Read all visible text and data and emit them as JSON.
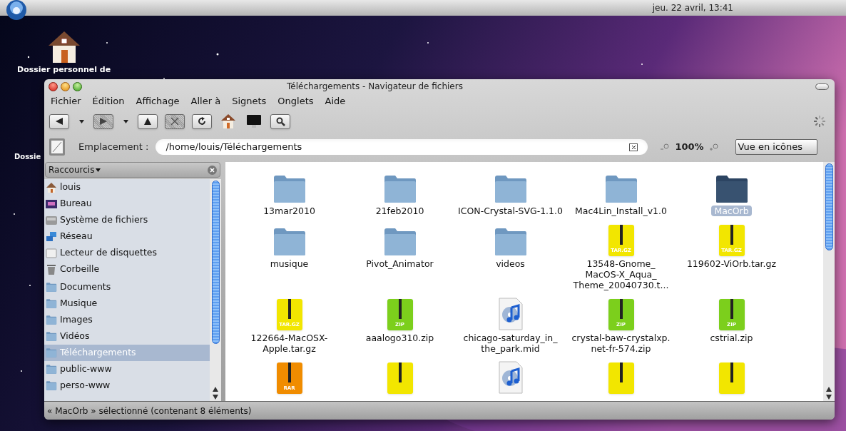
{
  "top_bar": {
    "clock": "jeu. 22 avril, 13:41"
  },
  "desktop_icons": [
    {
      "label": "Dossier personnel de",
      "kind": "home"
    },
    {
      "label": "Dossie",
      "kind": "hidden"
    }
  ],
  "window": {
    "title": "Téléchargements - Navigateur de fichiers"
  },
  "menu": [
    "Fichier",
    "Édition",
    "Affichage",
    "Aller à",
    "Signets",
    "Onglets",
    "Aide"
  ],
  "toolbar": [
    {
      "kind": "back",
      "disabled": false
    },
    {
      "kind": "dropdown",
      "disabled": false
    },
    {
      "kind": "forward",
      "disabled": true
    },
    {
      "kind": "dropdown",
      "disabled": false
    },
    {
      "kind": "up",
      "disabled": false
    },
    {
      "kind": "stop",
      "disabled": true
    },
    {
      "kind": "reload",
      "disabled": false
    },
    {
      "kind": "home",
      "disabled": false
    },
    {
      "kind": "computer",
      "disabled": false
    },
    {
      "kind": "search",
      "disabled": false
    }
  ],
  "location": {
    "label": "Emplacement :",
    "value": "/home/louis/Téléchargements",
    "zoom": "100%",
    "view": "Vue en icônes"
  },
  "sidebar": {
    "title": "Raccourcis",
    "items": [
      {
        "label": "louis",
        "kind": "home",
        "selected": false
      },
      {
        "label": "Bureau",
        "kind": "desktop",
        "selected": false
      },
      {
        "label": "Système de fichiers",
        "kind": "drive",
        "selected": false
      },
      {
        "label": "Réseau",
        "kind": "network",
        "selected": false
      },
      {
        "label": "Lecteur de disquettes",
        "kind": "floppy",
        "selected": false
      },
      {
        "label": "Corbeille",
        "kind": "trash",
        "selected": false
      },
      {
        "label": "Documents",
        "kind": "folder",
        "selected": false
      },
      {
        "label": "Musique",
        "kind": "folder",
        "selected": false
      },
      {
        "label": "Images",
        "kind": "folder",
        "selected": false
      },
      {
        "label": "Vidéos",
        "kind": "folder",
        "selected": false
      },
      {
        "label": "Téléchargements",
        "kind": "folder",
        "selected": true
      },
      {
        "label": "public-www",
        "kind": "folder",
        "selected": false
      },
      {
        "label": "perso-www",
        "kind": "folder",
        "selected": false
      }
    ]
  },
  "files": [
    {
      "name": "13mar2010",
      "kind": "folder",
      "selected": false
    },
    {
      "name": "21feb2010",
      "kind": "folder",
      "selected": false
    },
    {
      "name": "ICON-Crystal-SVG-1.1.0",
      "kind": "folder",
      "selected": false
    },
    {
      "name": "Mac4Lin_Install_v1.0",
      "kind": "folder",
      "selected": false
    },
    {
      "name": "MacOrb",
      "kind": "folder",
      "selected": true
    },
    {
      "name": "musique",
      "kind": "folder",
      "selected": false
    },
    {
      "name": "Pivot_Animator",
      "kind": "folder",
      "selected": false
    },
    {
      "name": "videos",
      "kind": "folder",
      "selected": false
    },
    {
      "name": "13548-Gnome_ MacOS-X_Aqua_ Theme_20040730.t...",
      "kind": "archive",
      "color": "#f2e600",
      "badge": "TAR.GZ",
      "selected": false
    },
    {
      "name": "119602-ViOrb.tar.gz",
      "kind": "archive",
      "color": "#f2e600",
      "badge": "TAR.GZ",
      "selected": false
    },
    {
      "name": "122664-MacOSX-Apple.tar.gz",
      "kind": "archive",
      "color": "#f2e600",
      "badge": "TAR.GZ",
      "selected": false
    },
    {
      "name": "aaalogo310.zip",
      "kind": "archive",
      "color": "#7ccf1c",
      "badge": "ZIP",
      "selected": false
    },
    {
      "name": "chicago-saturday_in_ the_park.mid",
      "kind": "audio",
      "selected": false
    },
    {
      "name": "crystal-baw-crystalxp. net-fr-574.zip",
      "kind": "archive",
      "color": "#7ccf1c",
      "badge": "ZIP",
      "selected": false
    },
    {
      "name": "cstrial.zip",
      "kind": "archive",
      "color": "#7ccf1c",
      "badge": "ZIP",
      "selected": false
    },
    {
      "kind": "archive",
      "color": "#f08c00",
      "badge": "RAR",
      "selected": false
    },
    {
      "kind": "archive",
      "color": "#f2e600",
      "selected": false
    },
    {
      "kind": "audio",
      "selected": false
    },
    {
      "kind": "archive",
      "color": "#f2e600",
      "selected": false
    },
    {
      "kind": "archive",
      "color": "#f2e600",
      "selected": false
    }
  ],
  "status_bar": "« MacOrb » sélectionné (contenant 8 éléments)"
}
